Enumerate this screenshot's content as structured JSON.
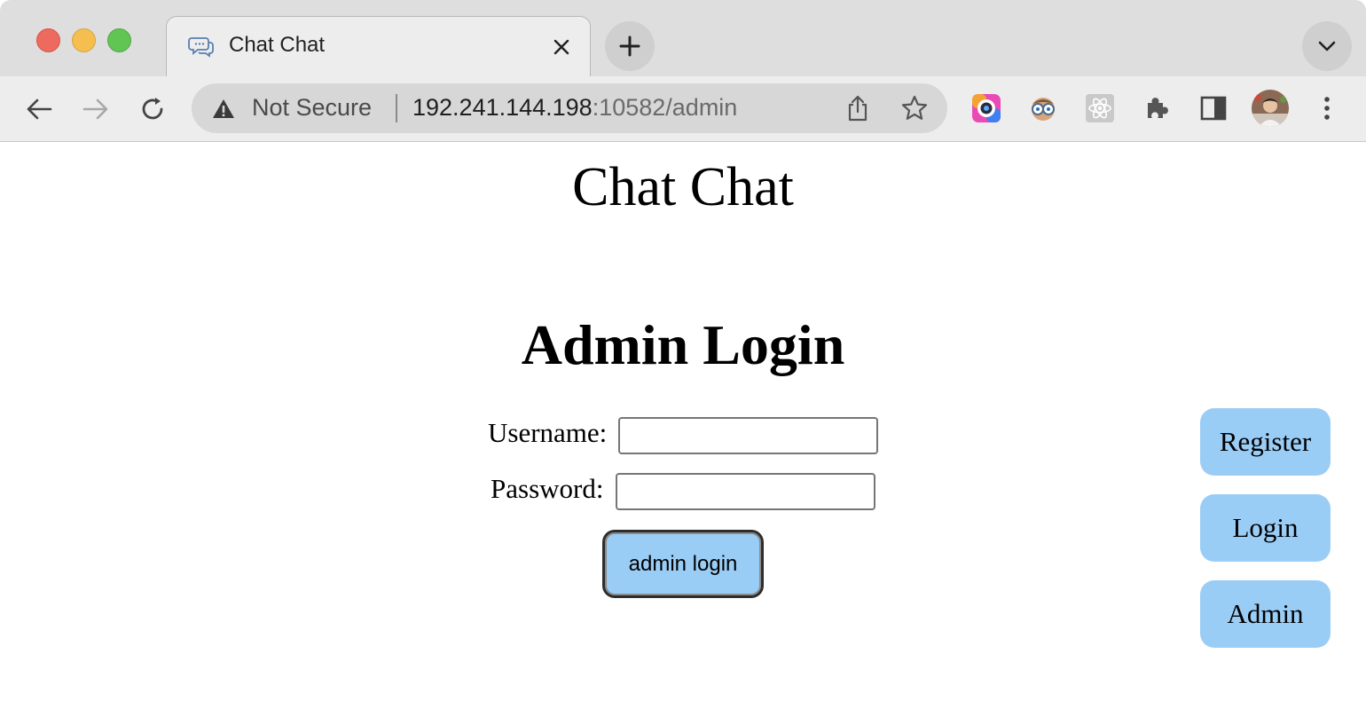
{
  "browser": {
    "tab": {
      "title": "Chat Chat",
      "icon": "chat-bubbles-icon"
    },
    "address_bar": {
      "security_label": "Not Secure",
      "host": "192.241.144.198",
      "path": ":10582/admin"
    }
  },
  "page": {
    "title": "Chat Chat",
    "heading": "Admin Login",
    "form": {
      "username_label": "Username:",
      "username_value": "",
      "password_label": "Password:",
      "password_value": "",
      "submit_label": "admin login"
    },
    "side_nav": [
      {
        "label": "Register"
      },
      {
        "label": "Login"
      },
      {
        "label": "Admin"
      }
    ]
  },
  "colors": {
    "button_fill": "#9acdf6",
    "close": "#ed6a5e",
    "minimize": "#f5bf4f",
    "maximize": "#61c554"
  }
}
